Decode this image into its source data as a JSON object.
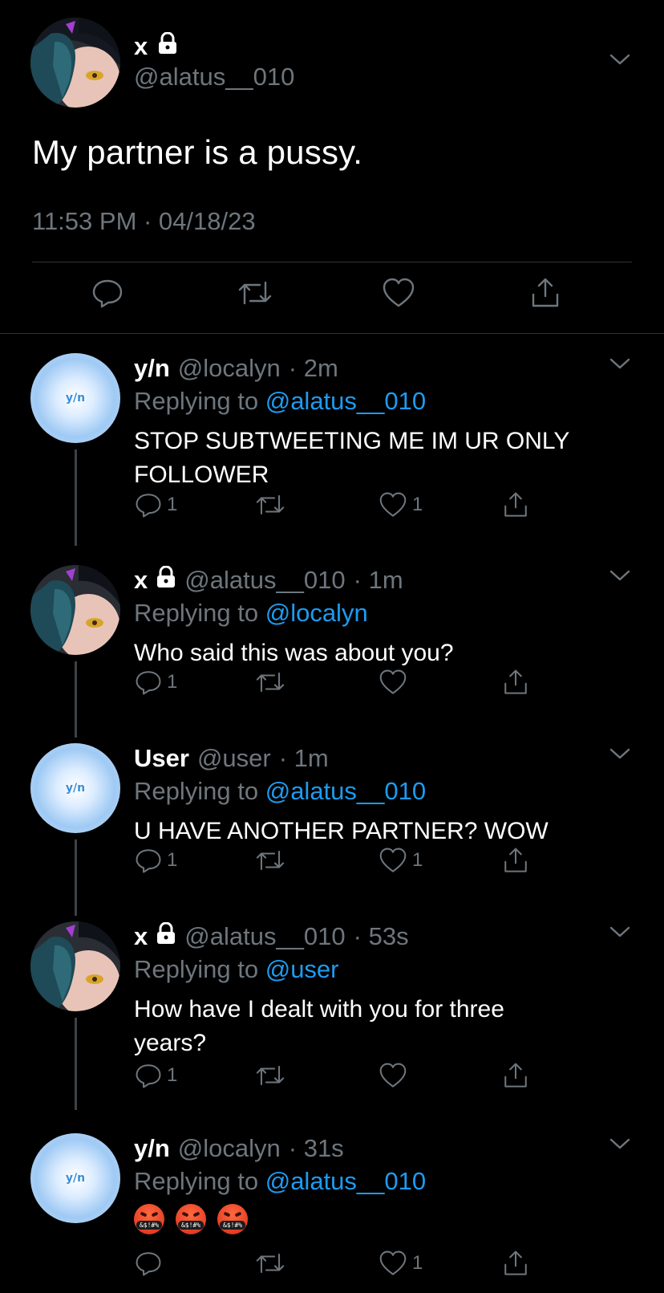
{
  "main_tweet": {
    "name": "x",
    "handle": "@alatus__010",
    "text": "My partner is a pussy.",
    "timestamp": "11:53 PM · 04/18/23",
    "avatar_icon": "anime-character-avatar"
  },
  "replies": [
    {
      "name": "y/n",
      "handle": "@localyn",
      "time": "· 2m",
      "replying_prefix": "Replying to",
      "replying_to": "@alatus__010",
      "text_line1": "STOP SUBTWEETING ME IM UR ONLY",
      "text_line2": "FOLLOWER",
      "reply_count": "1",
      "retweet_count": "",
      "like_count": "1",
      "avatar_text": "y/n"
    },
    {
      "name": "x",
      "handle": "@alatus__010",
      "time": "· 1m",
      "replying_prefix": "Replying to",
      "replying_to": "@localyn",
      "text_line1": "Who said this was about you?",
      "text_line2": "",
      "reply_count": "1",
      "retweet_count": "",
      "like_count": "",
      "avatar_text": ""
    },
    {
      "name": "User",
      "handle": "@user",
      "time": "· 1m",
      "replying_prefix": "Replying to",
      "replying_to": "@alatus__010",
      "text_line1": "U HAVE ANOTHER PARTNER? WOW",
      "text_line2": "",
      "reply_count": "1",
      "retweet_count": "",
      "like_count": "1",
      "avatar_text": "y/n"
    },
    {
      "name": "x",
      "handle": "@alatus__010",
      "time": "· 53s",
      "replying_prefix": "Replying to",
      "replying_to": "@user",
      "text_line1": "How have I dealt with you for three",
      "text_line2": "years?",
      "reply_count": "1",
      "retweet_count": "",
      "like_count": "",
      "avatar_text": ""
    },
    {
      "name": "y/n",
      "handle": "@localyn",
      "time": "· 31s",
      "replying_prefix": "Replying to",
      "replying_to": "@alatus__010",
      "emojis": [
        "angry-swearing-emoji",
        "angry-swearing-emoji",
        "angry-swearing-emoji"
      ],
      "emoji_text": "&$!#%",
      "reply_count": "",
      "retweet_count": "",
      "like_count": "1",
      "avatar_text": "y/n"
    }
  ],
  "colors": {
    "background": "#000000",
    "text": "#ffffff",
    "secondary": "#6e767d",
    "link": "#1d9bf0",
    "divider": "#2f3336"
  }
}
